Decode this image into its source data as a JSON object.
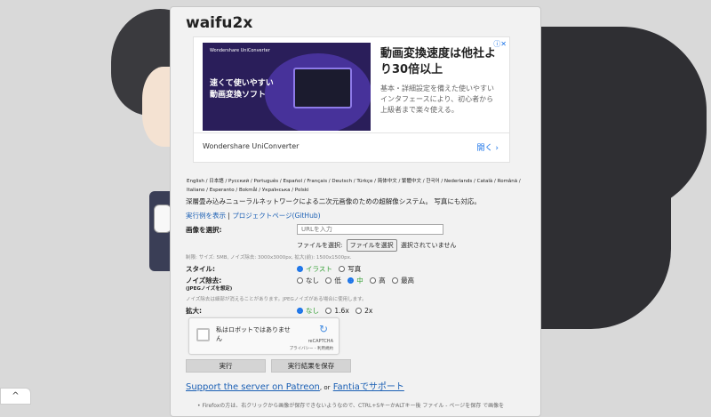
{
  "app": {
    "title": "waifu2x"
  },
  "ad": {
    "image_brand": "Wondershare UniConverter",
    "image_tagline_1": "速くて使いやすい",
    "image_tagline_2": "動画変換ソフト",
    "heading": "動画変換速度は他社より30倍以上",
    "subtext": "基本・詳細設定を備えた使いやすいインタフェースにより、初心者から上級者まで楽々使える。",
    "footer_name": "Wondershare UniConverter",
    "open_label": "開く",
    "close_icon": "close-icon"
  },
  "languages": "English / 日本語 / Русский / Português / Español / Français / Deutsch / Türkçe / 简体中文 / 繁體中文 / 한국어 / Nederlands / Català / Română / Italiano / Esperanto / Bokmål / Українська / Polski",
  "description": "深層畳み込みニューラルネットワークによる二次元画像のための超解像システム。 写真にも対応。",
  "links": {
    "example": "実行例を表示",
    "separator": "|",
    "project": "プロジェクトページ(GitHub)"
  },
  "image_select": {
    "label": "画像を選択:",
    "url_placeholder": "URLを入力",
    "file_label": "ファイルを選択:",
    "file_button": "ファイルを選択",
    "file_status": "選択されていません",
    "limits": "制限: サイズ: 5MB, ノイズ除去: 3000x3000px, 拡大(前): 1500x1500px."
  },
  "style": {
    "label": "スタイル:",
    "options": [
      {
        "label": "イラスト",
        "selected": true
      },
      {
        "label": "写真",
        "selected": false
      }
    ]
  },
  "noise": {
    "label": "ノイズ除去:",
    "sublabel": "(JPEGノイズを想定)",
    "options": [
      {
        "label": "なし",
        "selected": false
      },
      {
        "label": "低",
        "selected": false
      },
      {
        "label": "中",
        "selected": true
      },
      {
        "label": "高",
        "selected": false
      },
      {
        "label": "最高",
        "selected": false
      }
    ],
    "note": "ノイズ除去は細部が消えることがあります。JPEGノイズがある場合に使用します。"
  },
  "scale": {
    "label": "拡大:",
    "options": [
      {
        "label": "なし",
        "selected": true
      },
      {
        "label": "1.6x",
        "selected": false
      },
      {
        "label": "2x",
        "selected": false
      }
    ]
  },
  "captcha": {
    "text": "私はロボットではありません",
    "brand": "reCAPTCHA",
    "privacy": "プライバシー - 利用規約"
  },
  "buttons": {
    "run": "実行",
    "save": "実行結果を保存"
  },
  "support": {
    "patreon": "Support the server on Patreon",
    "or": ", or",
    "fantia": "Fantiaでサポート"
  },
  "footnote": "Firefoxの方は、右クリックから画像が保存できないようなので、CTRL+SキーかALTキー後 ファイル - ページを保存 で画像を",
  "scroll_up_glyph": "^",
  "colors": {
    "link": "#1a5fb4",
    "radio_selected": "#1a73e8",
    "selected_green": "#2e9d2e"
  }
}
